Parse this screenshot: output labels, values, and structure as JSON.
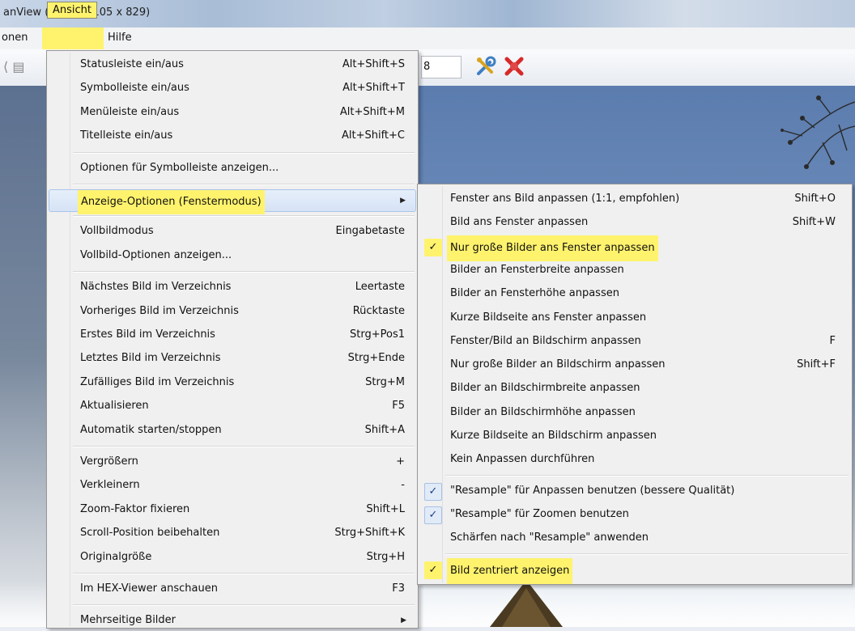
{
  "window": {
    "title": "anView (Zoom: 1105 x 829)"
  },
  "menubar": {
    "items": [
      "onen",
      "Ansicht",
      "Hilfe"
    ]
  },
  "toolbar": {
    "field_value": "8"
  },
  "menu": {
    "groups": [
      [
        {
          "label": "Statusleiste ein/aus",
          "shortcut": "Alt+Shift+S"
        },
        {
          "label": "Symbolleiste ein/aus",
          "shortcut": "Alt+Shift+T"
        },
        {
          "label": "Menüleiste ein/aus",
          "shortcut": "Alt+Shift+M"
        },
        {
          "label": "Titelleiste ein/aus",
          "shortcut": "Alt+Shift+C"
        }
      ],
      [
        {
          "label": "Optionen für Symbolleiste anzeigen...",
          "shortcut": ""
        }
      ],
      [
        {
          "label": "Anzeige-Optionen (Fenstermodus)",
          "shortcut": "",
          "submenu": true,
          "active": true
        }
      ],
      [
        {
          "label": "Vollbildmodus",
          "shortcut": "Eingabetaste"
        },
        {
          "label": "Vollbild-Optionen anzeigen...",
          "shortcut": ""
        }
      ],
      [
        {
          "label": "Nächstes Bild im Verzeichnis",
          "shortcut": "Leertaste"
        },
        {
          "label": "Vorheriges Bild im Verzeichnis",
          "shortcut": "Rücktaste"
        },
        {
          "label": "Erstes Bild im Verzeichnis",
          "shortcut": "Strg+Pos1"
        },
        {
          "label": "Letztes Bild im Verzeichnis",
          "shortcut": "Strg+Ende"
        },
        {
          "label": "Zufälliges Bild im Verzeichnis",
          "shortcut": "Strg+M"
        },
        {
          "label": "Aktualisieren",
          "shortcut": "F5"
        },
        {
          "label": "Automatik starten/stoppen",
          "shortcut": "Shift+A"
        }
      ],
      [
        {
          "label": "Vergrößern",
          "shortcut": "+"
        },
        {
          "label": "Verkleinern",
          "shortcut": "-"
        },
        {
          "label": "Zoom-Faktor fixieren",
          "shortcut": "Shift+L"
        },
        {
          "label": "Scroll-Position beibehalten",
          "shortcut": "Strg+Shift+K"
        },
        {
          "label": "Originalgröße",
          "shortcut": "Strg+H"
        }
      ],
      [
        {
          "label": "Im HEX-Viewer anschauen",
          "shortcut": "F3"
        }
      ],
      [
        {
          "label": "Mehrseitige Bilder",
          "shortcut": "",
          "submenu": true
        }
      ]
    ]
  },
  "submenu": {
    "groups": [
      [
        {
          "label": "Fenster ans Bild anpassen (1:1, empfohlen)",
          "shortcut": "Shift+O",
          "checked": false
        },
        {
          "label": "Bild ans Fenster anpassen",
          "shortcut": "Shift+W",
          "checked": false
        },
        {
          "label": "Nur große Bilder ans Fenster anpassen",
          "shortcut": "",
          "checked": true,
          "highlight": true
        },
        {
          "label": "Bilder an Fensterbreite anpassen",
          "shortcut": "",
          "checked": false
        },
        {
          "label": "Bilder an Fensterhöhe anpassen",
          "shortcut": "",
          "checked": false
        },
        {
          "label": "Kurze Bildseite ans Fenster anpassen",
          "shortcut": "",
          "checked": false
        },
        {
          "label": "Fenster/Bild an Bildschirm anpassen",
          "shortcut": "F",
          "checked": false
        },
        {
          "label": "Nur große Bilder an Bildschirm anpassen",
          "shortcut": "Shift+F",
          "checked": false
        },
        {
          "label": "Bilder an Bildschirmbreite anpassen",
          "shortcut": "",
          "checked": false
        },
        {
          "label": "Bilder an Bildschirmhöhe anpassen",
          "shortcut": "",
          "checked": false
        },
        {
          "label": "Kurze Bildseite an Bildschirm anpassen",
          "shortcut": "",
          "checked": false
        },
        {
          "label": "Kein Anpassen durchführen",
          "shortcut": "",
          "checked": false
        }
      ],
      [
        {
          "label": "\"Resample\" für Anpassen benutzen (bessere Qualität)",
          "shortcut": "",
          "checked": true
        },
        {
          "label": "\"Resample\" für Zoomen benutzen",
          "shortcut": "",
          "checked": true
        },
        {
          "label": "Schärfen nach \"Resample\" anwenden",
          "shortcut": "",
          "checked": false
        }
      ],
      [
        {
          "label": "Bild zentriert anzeigen",
          "shortcut": "",
          "checked": true,
          "highlight": true
        }
      ]
    ]
  },
  "colors": {
    "highlight": "#fff36d",
    "menu_bg": "#f0f0f0",
    "check": "#1a3f8a"
  }
}
